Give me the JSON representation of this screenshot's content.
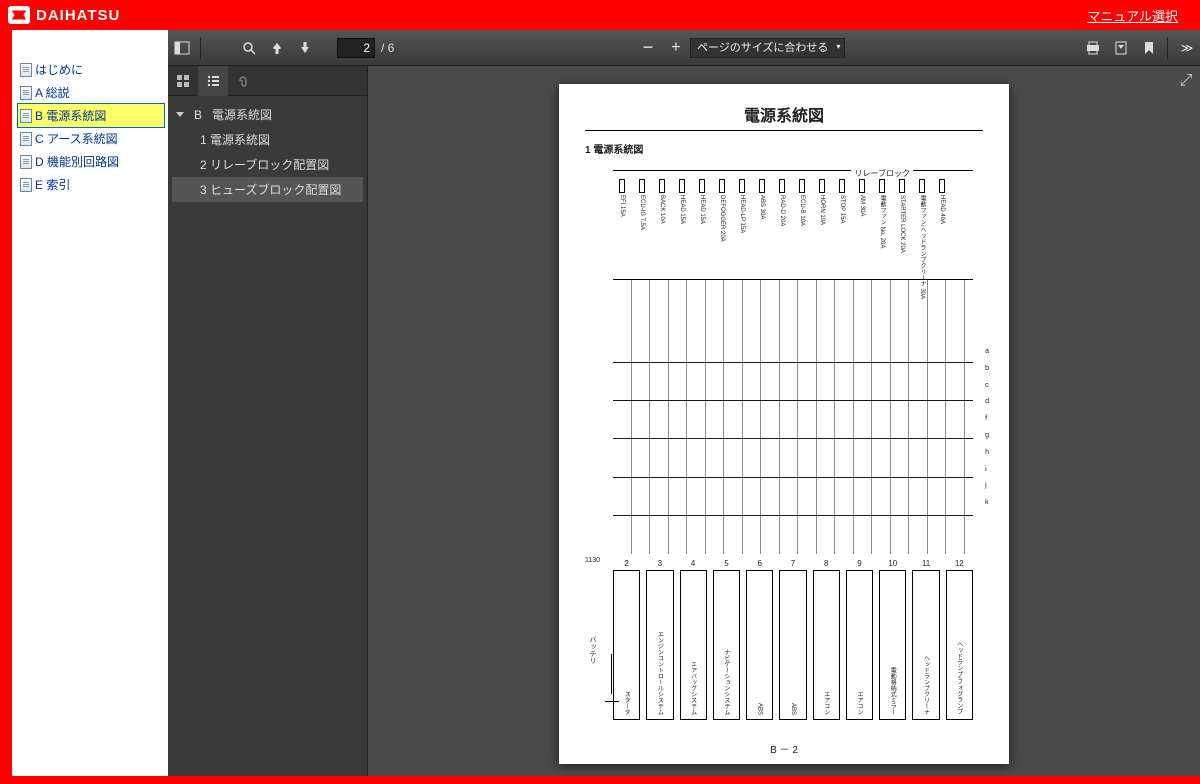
{
  "brand": "DAIHATSU",
  "top_link": "マニュアル選択",
  "nav": [
    {
      "label": "はじめに"
    },
    {
      "label": "A 総説"
    },
    {
      "label": "B 電源系統図",
      "selected": true
    },
    {
      "label": "C アース系統図"
    },
    {
      "label": "D 機能別回路図"
    },
    {
      "label": "E 索引"
    }
  ],
  "pdf": {
    "page_current": "2",
    "page_total": "/ 6",
    "zoom_label": "ページのサイズに合わせる"
  },
  "outline": {
    "section_letter": "B",
    "section_title": "電源系統図",
    "items": [
      {
        "label": "1 電源系統図"
      },
      {
        "label": "2 リレーブロック配置図"
      },
      {
        "label": "3 ヒューズブロック配置図",
        "selected": true
      }
    ]
  },
  "page": {
    "title": "電源系統図",
    "subtitle": "1 電源系統図",
    "relay_block_label": "リレーブロック",
    "battery_label": "バッテリ",
    "ref": "1130",
    "footer": "B － 2",
    "fuses": [
      {
        "name": "EFI 15A"
      },
      {
        "name": "ECU-IG 7.5A"
      },
      {
        "name": "BACK 10A"
      },
      {
        "name": "HEAD 15A"
      },
      {
        "name": "HEAD 15A"
      },
      {
        "name": "DEFOGGER 20A"
      },
      {
        "name": "HEAD-LP 15A"
      },
      {
        "name": "ABS 30A"
      },
      {
        "name": "RAD-D 20A"
      },
      {
        "name": "ECU-B 10A"
      },
      {
        "name": "HORN 10A"
      },
      {
        "name": "STOP 15A"
      },
      {
        "name": "AM 30A"
      },
      {
        "name": "電動ファン No. 20A"
      },
      {
        "name": "STARTER LOCK 20A"
      },
      {
        "name": "電動ファン/ヘッドランプクリーナ 30A"
      },
      {
        "name": "HEAD 40A"
      }
    ],
    "right_labels": [
      "a",
      "b",
      "c",
      "d",
      "f",
      "g",
      "h",
      "i",
      "j",
      "k"
    ],
    "connectors": [
      {
        "num": "2",
        "label": "スタータ"
      },
      {
        "num": "3",
        "label": "エンジンコントロールシステム"
      },
      {
        "num": "4",
        "label": "エアバッグシステム"
      },
      {
        "num": "5",
        "label": "ナビゲーションシステム"
      },
      {
        "num": "6",
        "label": "ABS"
      },
      {
        "num": "7",
        "label": "ABS"
      },
      {
        "num": "8",
        "label": "エアコン"
      },
      {
        "num": "9",
        "label": "エアコン"
      },
      {
        "num": "10",
        "label": "電動格納式ミラー"
      },
      {
        "num": "11",
        "label": "ヘッドランプクリーナ"
      },
      {
        "num": "12",
        "label": "ヘッドランプ/フォグランプ"
      }
    ]
  }
}
